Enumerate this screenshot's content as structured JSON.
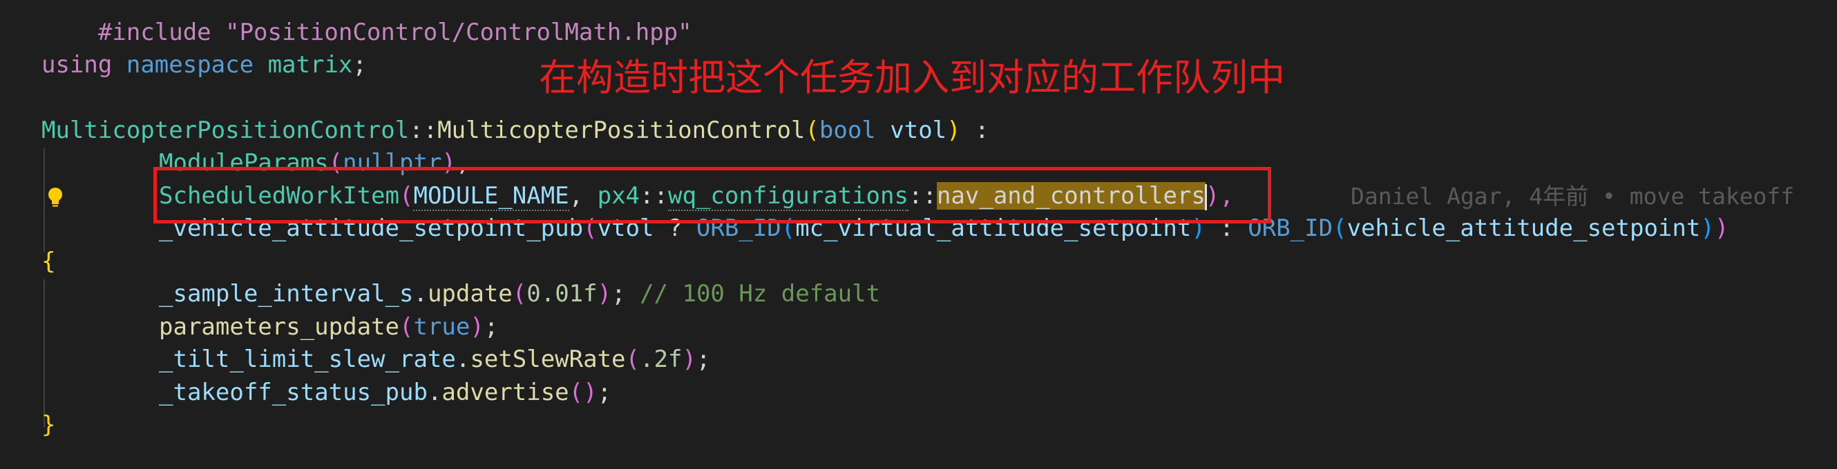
{
  "editor": {
    "lines": {
      "l0": "#include \"PositionControl/ControlMath.hpp\"",
      "using_kw": "using",
      "namespace_kw": "namespace",
      "namespace_name": "matrix",
      "semicolon": ";",
      "class_name": "MulticopterPositionControl",
      "scope": "::",
      "ctor_name": "MulticopterPositionControl",
      "open_paren": "(",
      "bool_kw": "bool",
      "param_vtol": "vtol",
      "close_paren": ")",
      "colon": " :",
      "module_params": "ModuleParams",
      "nullptr_kw": "nullptr",
      "mp_tail": ",",
      "sched_item": "ScheduledWorkItem",
      "module_name": "MODULE_NAME",
      "comma_space": ", ",
      "px4_ns": "px4",
      "wq_ns": "wq_configurations",
      "nav_ctrl": "nav_and_controllers",
      "close_comma": "),",
      "veh_att_pub": "_vehicle_attitude_setpoint_pub",
      "vtol_ref": "vtol",
      "ternary_q": " ? ",
      "orb_id_1": "ORB_ID",
      "mc_virtual": "mc_virtual_attitude_setpoint",
      "ternary_colon": " : ",
      "orb_id_2": "ORB_ID",
      "veh_att_sp": "vehicle_attitude_setpoint",
      "open_brace": "{",
      "sample_interval": "_sample_interval_s",
      "dot": ".",
      "update_fn": "update",
      "num_001f": "0.01f",
      "comment_100hz": "// 100 Hz default",
      "parameters_update": "parameters_update",
      "true_kw": "true",
      "tilt_limit": "_tilt_limit_slew_rate",
      "set_slew_rate": "setSlewRate",
      "num_2f": ".2f",
      "takeoff_pub": "_takeoff_status_pub",
      "advertise_fn": "advertise",
      "close_brace": "}"
    },
    "blame": "Daniel Agar, 4年前 • move takeoff"
  },
  "annotation": {
    "text": "在构造时把这个任务加入到对应的工作队列中"
  },
  "icons": {
    "lightbulb": "lightbulb-icon"
  },
  "colors": {
    "background": "#1e1e1e",
    "annotation_red": "#e02020",
    "selection": "#8a6a12"
  }
}
